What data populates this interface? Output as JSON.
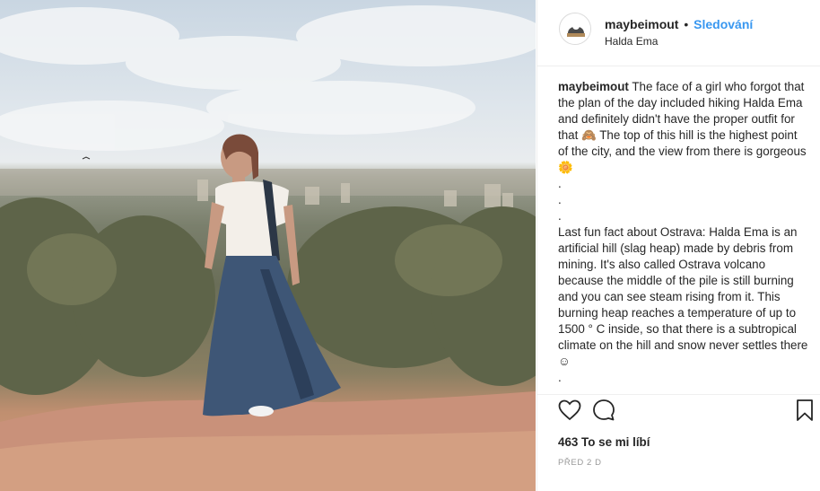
{
  "post": {
    "username": "maybeimout",
    "separator": "•",
    "follow_label": "Sledování",
    "location": "Halda Ema",
    "photo_alt": "Girl hiking on Halda Ema hill with city view",
    "caption_username": "maybeimout",
    "caption_text": "The face of a girl who forgot that the plan of the day included hiking Halda Ema and definitely didn't have the proper outfit for that 🙈 The top of this hill is the highest point of the city, and the view from there is gorgeous 🌼\n.\n.\n.\nLast fun fact about Ostrava: Halda Ema is an artificial hill (slag heap) made by debris from mining. It's also called Ostrava volcano because the middle of the pile is still burning and you can see steam rising from it. This burning heap reaches a temperature of up to 1500 ° C inside, so that there is a subtropical climate on the hill and snow never settles there ☺\n.",
    "likes_text": "463 To se mi líbí",
    "time_text": "PŘED 2 D"
  },
  "icons": {
    "like": "heart-icon",
    "comment": "comment-bubble-icon",
    "save": "bookmark-icon"
  },
  "colors": {
    "follow": "#3897f0",
    "text": "#262626",
    "meta": "#999999",
    "border": "#efefef"
  }
}
